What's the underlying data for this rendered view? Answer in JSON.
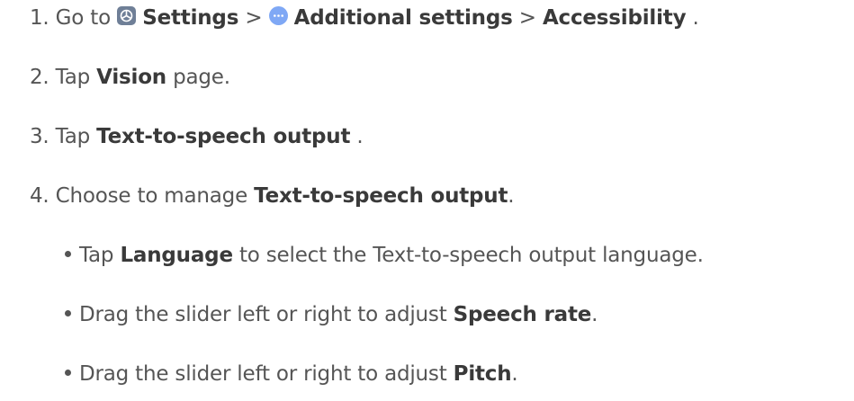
{
  "step1": {
    "number": "1.",
    "prefix": "Go to",
    "settings": "Settings",
    "sep1": ">",
    "additional": "Additional settings",
    "sep2": ">",
    "accessibility": "Accessibility",
    "end": "."
  },
  "step2": {
    "number": "2.",
    "prefix": "Tap",
    "vision": "Vision",
    "suffix": "page."
  },
  "step3": {
    "number": "3.",
    "prefix": "Tap",
    "tts": "Text-to-speech output",
    "end": "."
  },
  "step4": {
    "number": "4.",
    "prefix": "Choose to manage",
    "tts": "Text-to-speech output",
    "end": "."
  },
  "bullets": [
    {
      "prefix": "Tap",
      "bold": "Language",
      "suffix": "to select the Text-to-speech output language."
    },
    {
      "prefix": "Drag the slider left or right to adjust",
      "bold": "Speech rate",
      "suffix": "."
    },
    {
      "prefix": "Drag the slider left or right to adjust",
      "bold": "Pitch",
      "suffix": "."
    }
  ],
  "icons": {
    "settings": "settings-app-icon",
    "additional_settings": "more-dots-icon",
    "settings_color": "#6f7f97",
    "additional_color": "#7fa8f5"
  }
}
